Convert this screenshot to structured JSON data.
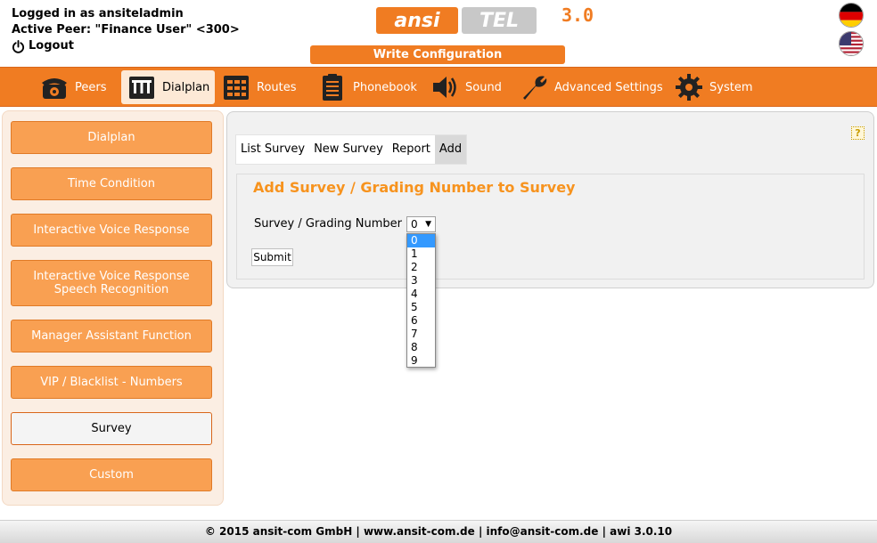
{
  "header": {
    "logged_in": "Logged in as ansiteladmin",
    "active_peer": "Active Peer: \"Finance User\" <300>",
    "logout": "Logout",
    "logo_text_1": "ansi",
    "logo_text_2": "TEL",
    "logo_text_3": "3.0",
    "write_config": "Write Configuration",
    "flags": [
      "germany-flag",
      "usa-flag"
    ]
  },
  "nav": {
    "items": [
      {
        "label": "Peers",
        "icon": "phone-icon"
      },
      {
        "label": "Dialplan",
        "icon": "dialplan-icon"
      },
      {
        "label": "Routes",
        "icon": "routes-icon"
      },
      {
        "label": "Phonebook",
        "icon": "phonebook-icon"
      },
      {
        "label": "Sound",
        "icon": "speaker-icon"
      },
      {
        "label": "Advanced Settings",
        "icon": "wrench-icon"
      },
      {
        "label": "System",
        "icon": "gear-icon"
      }
    ],
    "active": "Dialplan"
  },
  "sidebar": {
    "items": [
      {
        "label": "Dialplan"
      },
      {
        "label": "Time Condition"
      },
      {
        "label": "Interactive Voice Response"
      },
      {
        "label": "Interactive Voice Response",
        "label2": "Speech Recognition"
      },
      {
        "label": "Manager Assistant Function"
      },
      {
        "label": "VIP / Blacklist - Numbers"
      },
      {
        "label": "Survey"
      },
      {
        "label": "Custom"
      }
    ],
    "active": "Survey"
  },
  "main": {
    "help": "?",
    "tabs": [
      "List Survey",
      "New Survey",
      "Report",
      "Add"
    ],
    "active_tab": "Add",
    "form_title": "Add Survey / Grading Number to Survey",
    "field_label": "Survey / Grading Number",
    "select_value": "0",
    "options": [
      "0",
      "1",
      "2",
      "3",
      "4",
      "5",
      "6",
      "7",
      "8",
      "9"
    ],
    "submit": "Submit"
  },
  "footer": {
    "text": "© 2015 ansit-com GmbH | www.ansit-com.de | info@ansit-com.de | awi 3.0.10"
  },
  "colors": {
    "accent": "#f07c22",
    "sidebar_button": "#f9a052",
    "title": "#f7931e",
    "selected_option": "#3399ff"
  }
}
